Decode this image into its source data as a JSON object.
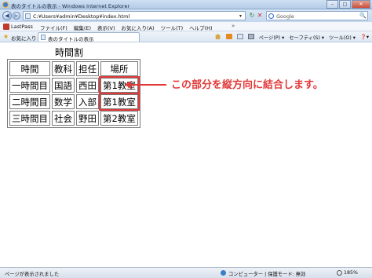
{
  "window": {
    "title": "表のタイトルの表示 - Windows Internet Explorer",
    "minimize_glyph": "–",
    "maximize_glyph": "□",
    "close_glyph": "✕"
  },
  "address_bar": {
    "back_glyph": "◀",
    "forward_glyph": "▶",
    "url": "C:¥Users¥admin¥Desktop¥index.html",
    "dropdown_glyph": "▾",
    "refresh_glyph": "↻",
    "stop_glyph": "✕",
    "search_placeholder": "Google",
    "search_glyph": "🔍"
  },
  "menu_bar": {
    "lastpass_label": "LastPass",
    "items": [
      "ファイル(F)",
      "編集(E)",
      "表示(V)",
      "お気に入り(A)",
      "ツール(T)",
      "ヘルプ(H)"
    ],
    "overflow_glyph": "»"
  },
  "favorites_bar": {
    "favorites_label": "お気に入り",
    "tab_title": "表のタイトルの表示",
    "commands": [
      "ページ(P) ▾",
      "セーフティ(S) ▾",
      "ツール(O) ▾",
      "❓▾"
    ]
  },
  "timetable": {
    "caption": "時間割",
    "headers": [
      "時間",
      "教科",
      "担任",
      "場所"
    ],
    "rows": [
      [
        "一時間目",
        "国語",
        "西田",
        "第1教室"
      ],
      [
        "二時間目",
        "数学",
        "入部",
        "第1教室"
      ],
      [
        "三時間目",
        "社会",
        "野田",
        "第2教室"
      ]
    ]
  },
  "annotation": {
    "text": "この部分を縦方向に結合します。",
    "color": "#e23a3a"
  },
  "status_bar": {
    "status_text": "ページが表示されました",
    "zone_text": "コンピューター | 保護モード: 無効",
    "zoom_text": "185%"
  }
}
